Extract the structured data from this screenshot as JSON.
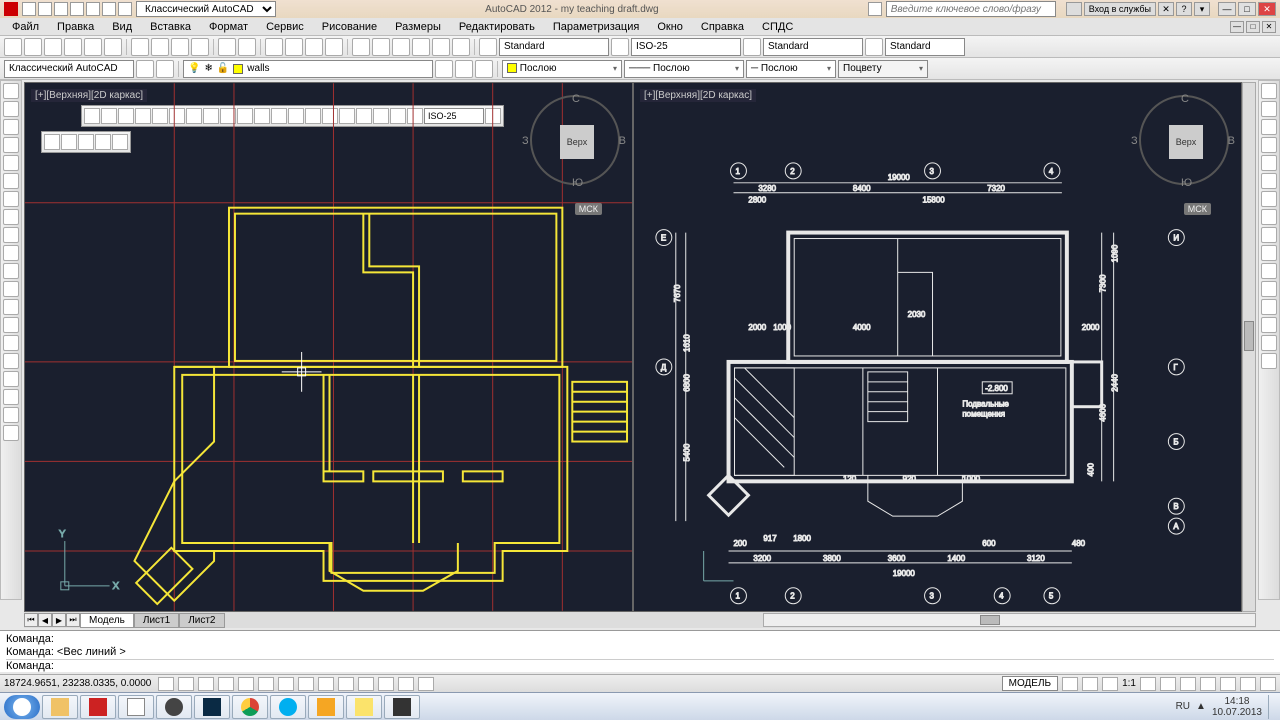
{
  "title": "AutoCAD 2012 - my teaching draft.dwg",
  "workspace": "Классический AutoCAD",
  "search_placeholder": "Введите ключевое слово/фразу",
  "login": "Вход в службы",
  "menu": [
    "Файл",
    "Правка",
    "Вид",
    "Вставка",
    "Формат",
    "Сервис",
    "Рисование",
    "Размеры",
    "Редактировать",
    "Параметризация",
    "Окно",
    "Справка",
    "СПДС"
  ],
  "styles": {
    "text_style": "Standard",
    "dim_style": "ISO-25",
    "table_style": "Standard",
    "ml_style": "Standard"
  },
  "layer": {
    "current": "walls",
    "ws_combo": "Классический AutoCAD"
  },
  "props": {
    "color": "Послою",
    "ltype": "Послою",
    "lweight": "Послою",
    "plot": "Поцвету"
  },
  "dim_toolbar_style": "ISO-25",
  "viewport": {
    "label": "[+][Верхняя][2D каркас]",
    "cube_face": "Верх",
    "msk": "МСК",
    "compass_n": "С",
    "compass_s": "Ю",
    "compass_e": "В",
    "compass_w": "З"
  },
  "tabs": {
    "model": "Модель",
    "l1": "Лист1",
    "l2": "Лист2"
  },
  "cmd": {
    "l1": "Команда:",
    "l2": "Команда:  <Вес линий >",
    "l3": "Команда:"
  },
  "status": {
    "coords": "18724.9651, 23238.0335, 0.0000",
    "model": "МОДЕЛЬ",
    "scale": "1:1"
  },
  "taskbar": {
    "time": "14:18",
    "date": "10.07.2013",
    "lang": "RU"
  },
  "drawing_right": {
    "overall_w": "19000",
    "span12": "3280",
    "span23": "8400",
    "span34": "7320",
    "w1": "2800",
    "w2": "15800",
    "alt_span": "3200",
    "h_left": "6800",
    "h_right": "7300",
    "h_mid": "4600",
    "r1": "2000",
    "r2": "1000",
    "r3": "2030",
    "r4": "4000",
    "r5": "2000",
    "b1": "917",
    "b2": "1800",
    "b3": "3800",
    "b4": "3600",
    "b5": "1400",
    "b6": "3120",
    "label_pod": "Подвальные",
    "label_pod2": "помещения",
    "lvl": "-2.800",
    "d1": "120",
    "d2": "920",
    "d3": "1000",
    "d4": "600",
    "d5": "480",
    "d6": "2440",
    "d7": "400",
    "left_h1": "7670",
    "left_h2": "1610",
    "left_h3": "5400",
    "left_r": "200",
    "rh": "1090",
    "ax1": "1",
    "ax2": "2",
    "ax3": "3",
    "ax4": "4",
    "ax5": "5",
    "axA": "А",
    "axB": "Б",
    "axV": "В",
    "axG": "Г",
    "axD": "Д",
    "axE": "Е",
    "axI": "И"
  }
}
